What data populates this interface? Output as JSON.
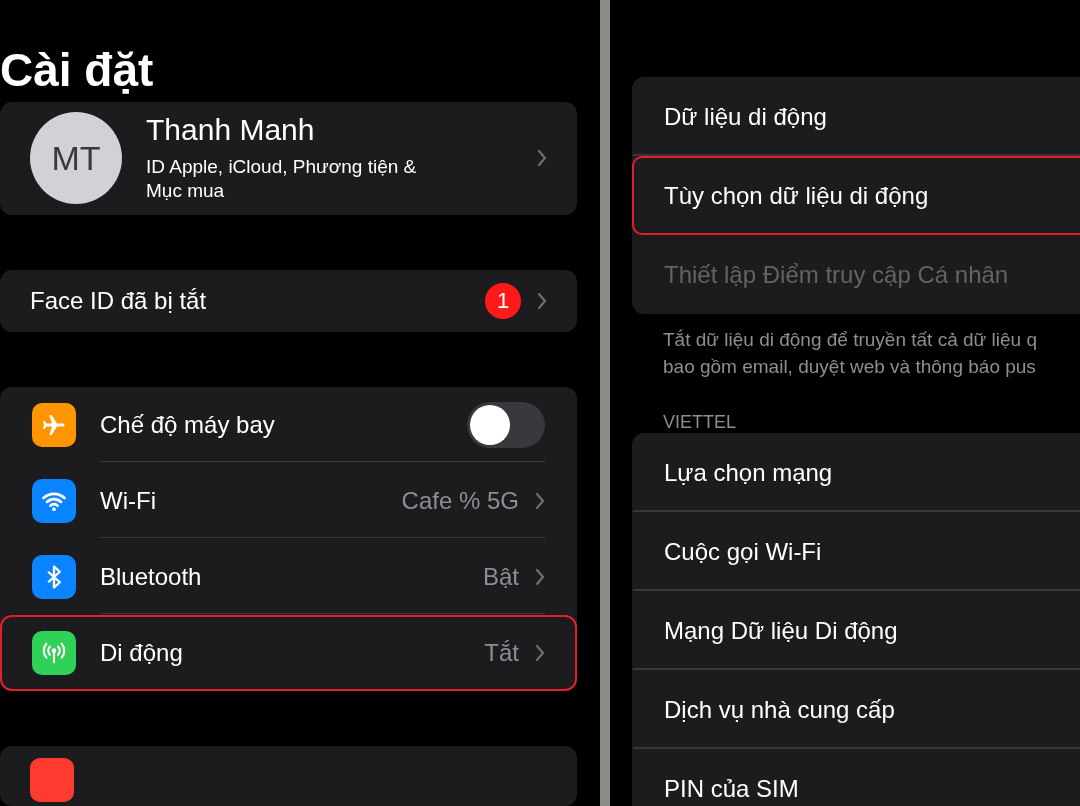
{
  "left": {
    "title": "Cài đặt",
    "profile": {
      "initials": "MT",
      "name": "Thanh Manh",
      "subtitle": "ID Apple, iCloud, Phương tiện & Mục mua"
    },
    "alert": {
      "label": "Face ID đã bị tắt",
      "badge": "1"
    },
    "settings": [
      {
        "kind": "toggle",
        "label": "Chế độ máy bay",
        "color": "#ff9500",
        "on": false,
        "highlighted": false
      },
      {
        "kind": "link",
        "label": "Wi-Fi",
        "value": "Cafe % 5G",
        "color": "#0a84ff",
        "highlighted": false
      },
      {
        "kind": "link",
        "label": "Bluetooth",
        "value": "Bật",
        "color": "#0a84ff",
        "highlighted": false
      },
      {
        "kind": "link",
        "label": "Di động",
        "value": "Tắt",
        "color": "#30d158",
        "highlighted": true
      }
    ]
  },
  "right": {
    "data_rows": [
      {
        "label": "Dữ liệu di động",
        "disabled": false,
        "highlighted": false
      },
      {
        "label": "Tùy chọn dữ liệu di động",
        "disabled": false,
        "highlighted": true
      },
      {
        "label": "Thiết lập Điểm truy cập Cá nhân",
        "disabled": true,
        "highlighted": false
      }
    ],
    "footer": "Tắt dữ liệu di động để truyền tất cả dữ liệu q\nbao gồm email, duyệt web và thông báo pus",
    "section_header": "VIETTEL",
    "carrier_rows": [
      {
        "label": "Lựa chọn mạng"
      },
      {
        "label": "Cuộc gọi Wi-Fi"
      },
      {
        "label": "Mạng Dữ liệu Di động"
      },
      {
        "label": "Dịch vụ nhà cung cấp"
      },
      {
        "label": "PIN của SIM"
      }
    ]
  }
}
